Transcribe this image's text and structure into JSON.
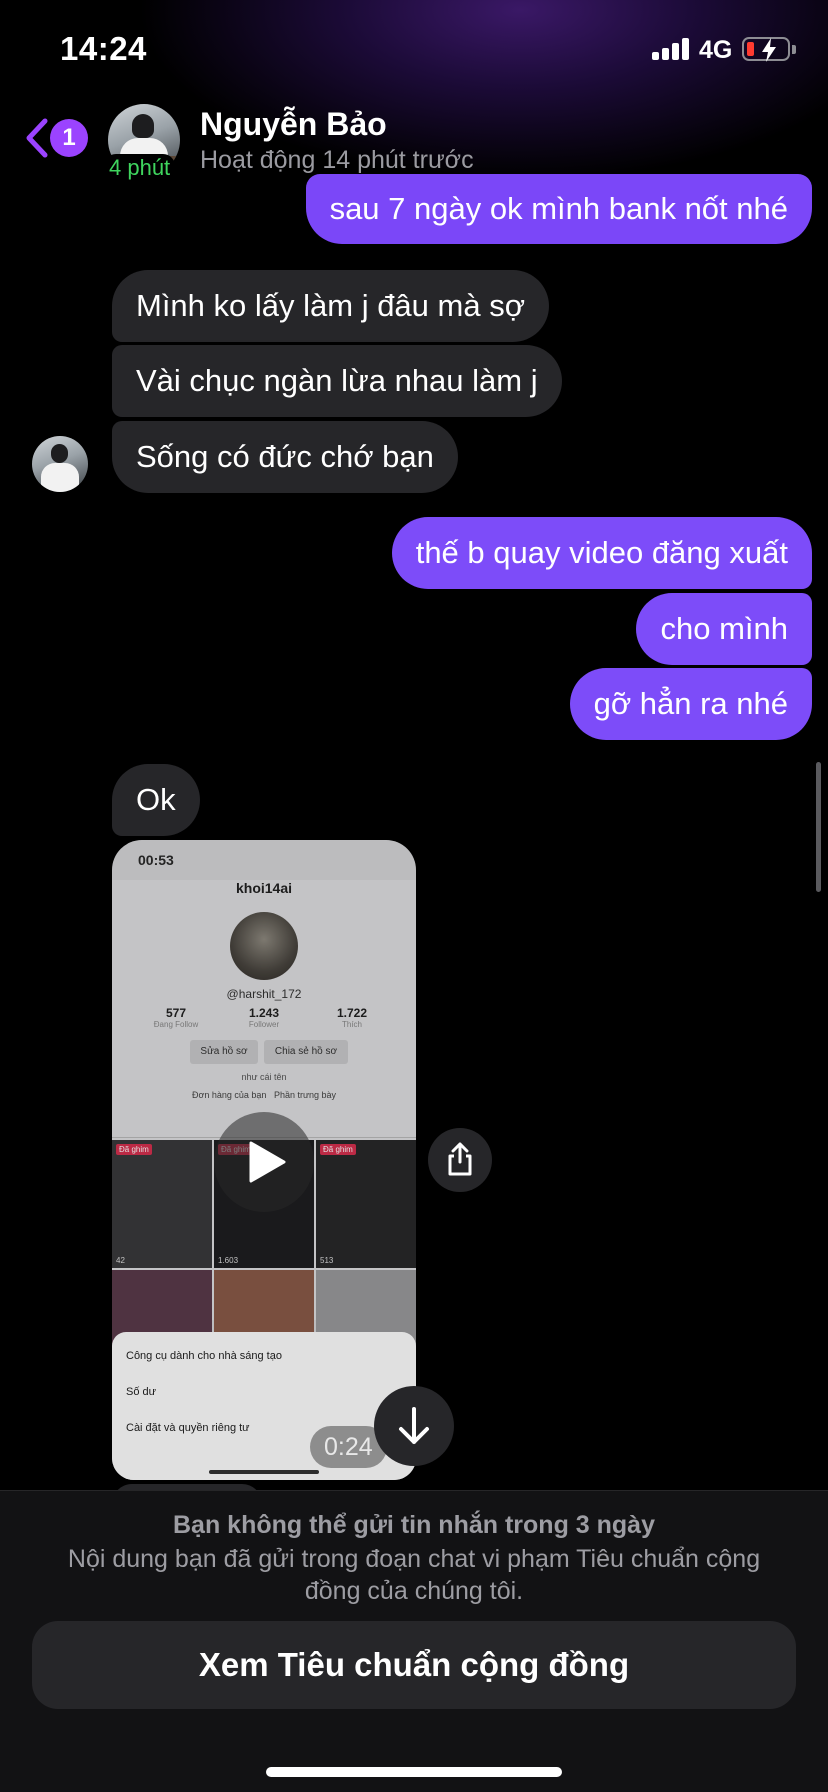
{
  "status_bar": {
    "time": "14:24",
    "network": "4G"
  },
  "header": {
    "back_badge": "1",
    "contact_name": "Nguyễn Bảo",
    "avatar_active_label": "4 phút",
    "activity_status": "Hoạt động 14 phút trước"
  },
  "messages": [
    {
      "side": "out",
      "text": "sau 7 ngày ok mình bank nốt nhé"
    },
    {
      "side": "in",
      "text": "Mình ko lấy làm j đâu mà sợ"
    },
    {
      "side": "in",
      "text": "Vài chục ngàn lừa nhau làm j"
    },
    {
      "side": "in",
      "text": "Sống có đức chớ bạn"
    },
    {
      "side": "out",
      "text": "thế b quay video đăng xuất"
    },
    {
      "side": "out",
      "text": "cho mình"
    },
    {
      "side": "out",
      "text": "gỡ hẳn ra nhé"
    },
    {
      "side": "in",
      "text": "Ok"
    }
  ],
  "video_message": {
    "duration": "0:24",
    "preview": {
      "time": "00:53",
      "username": "khoi14ai",
      "handle": "@harshit_172",
      "stats": [
        {
          "value": "577",
          "label": "Đang Follow"
        },
        {
          "value": "1.243",
          "label": "Follower"
        },
        {
          "value": "1.722",
          "label": "Thích"
        }
      ],
      "buttons": [
        "Sửa hồ sơ",
        "Chia sẻ hồ sơ"
      ],
      "bio": "như cái tên",
      "links": [
        "Đơn hàng của bạn",
        "Phần trưng bày"
      ],
      "grid_tag": "Đã ghim",
      "grid_views": [
        "42",
        "1.603",
        "513"
      ],
      "sheet_items": [
        "Công cụ dành cho nhà sáng tạo",
        "Số dư",
        "Cài đặt và quyền riêng tư"
      ]
    }
  },
  "restriction": {
    "title": "Bạn không thể gửi tin nhắn trong 3 ngày",
    "description": "Nội dung bạn đã gửi trong đoạn chat vi phạm Tiêu chuẩn cộng đồng của chúng tôi.",
    "button_label": "Xem Tiêu chuẩn cộng đồng"
  },
  "colors": {
    "outgoing_bubble": "#7d4cf9",
    "incoming_bubble": "#262629",
    "badge": "#9b43ff",
    "active_green": "#3fd55e"
  }
}
